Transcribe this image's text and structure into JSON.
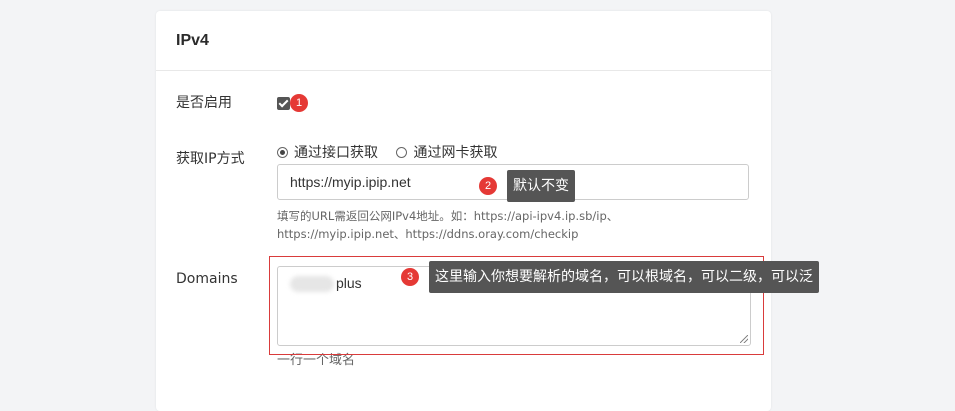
{
  "card": {
    "title": "IPv4"
  },
  "enable": {
    "label": "是否启用",
    "checked": true,
    "badge": "1"
  },
  "ip_method": {
    "label": "获取IP方式",
    "options": [
      {
        "label": "通过接口获取",
        "selected": true
      },
      {
        "label": "通过网卡获取",
        "selected": false
      }
    ],
    "url_value": "https://myip.ipip.net",
    "badge": "2",
    "tooltip": "默认不变",
    "help_text": "填写的URL需返回公网IPv4地址。如：https://api-ipv4.ip.sb/ip、https://myip.ipip.net、https://ddns.oray.com/checkip"
  },
  "domains": {
    "label": "Domains",
    "value_suffix": "plus",
    "badge": "3",
    "tooltip": "这里输入你想要解析的域名，可以根域名，可以二级，可以泛",
    "help_text": "一行一个域名"
  },
  "colors": {
    "badge": "#e53935",
    "tooltip_bg": "#555555",
    "highlight_border": "#d93b3b"
  }
}
